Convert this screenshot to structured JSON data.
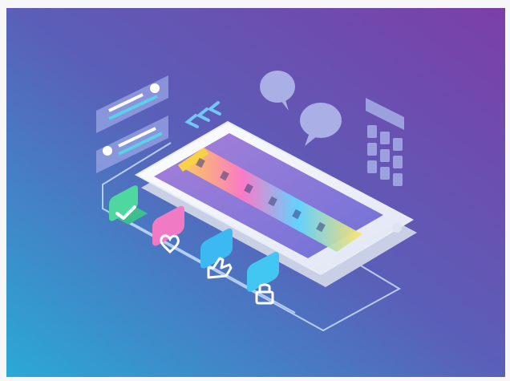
{
  "scene": {
    "colors": {
      "bg_top_right": "#7b3fa8",
      "bg_mid": "#5a5fb8",
      "bg_bottom_left": "#2aa9d6",
      "phone_body": "#eef1f8",
      "phone_edge": "#c9d0e6",
      "screen_top": "#a77fd8",
      "screen_bottom": "#6f72d8",
      "check_tile": "#4fd7a0",
      "heart_tile": "#f07bc4",
      "like_tile": "#3bb9f0",
      "bag_tile": "#42c7f2",
      "chat_panel": "#9aa6e6",
      "line_accent": "#56d3e8"
    },
    "icons": [
      "check-icon",
      "heart-icon",
      "thumbs-up-icon",
      "shopping-bag-icon",
      "speech-bubble-icon",
      "grid-keypad-icon",
      "user-chat-icon",
      "chevron-left-icon"
    ]
  }
}
